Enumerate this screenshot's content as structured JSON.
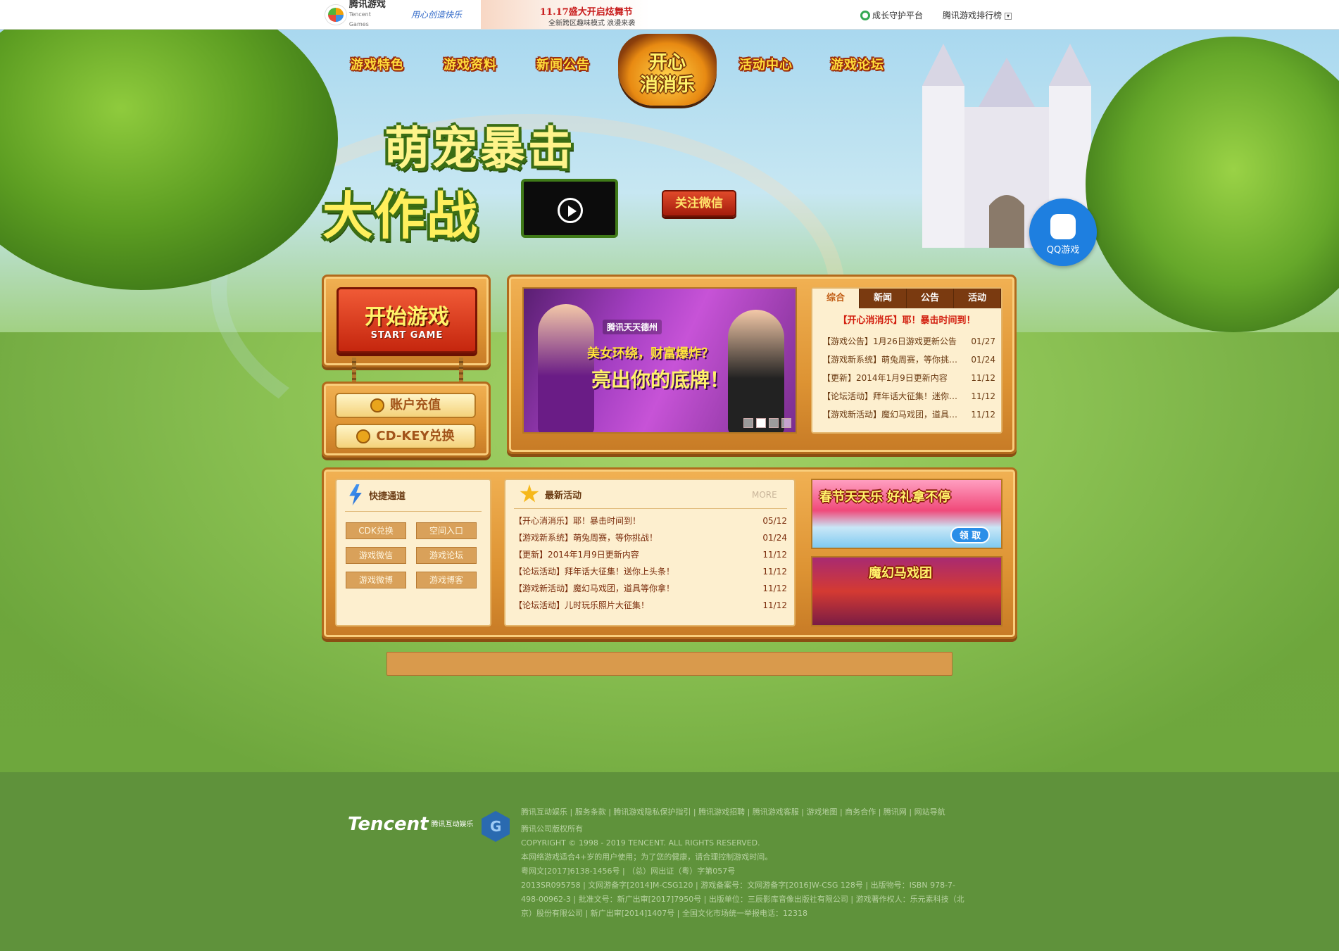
{
  "topbar": {
    "brand_name": "腾讯游戏",
    "brand_en": "Tencent Games",
    "slogan": "用心创造快乐",
    "ad_line1": "11.17盛大开启炫舞节",
    "ad_line2": "全新跨区趣味模式 浪漫来袭",
    "guardian": "成长守护平台",
    "ranking": "腾讯游戏排行榜"
  },
  "nav": {
    "items": [
      "游戏特色",
      "游戏资料",
      "新闻公告",
      "活动中心",
      "游戏论坛"
    ],
    "logo_line1": "开心",
    "logo_line2": "消消乐"
  },
  "hero": {
    "title_line1": "萌宠暴击",
    "title_line2": "大作战",
    "follow_label": "关注微信"
  },
  "qq_float": {
    "label": "QQ游戏"
  },
  "start": {
    "label_cn": "开始游戏",
    "label_en": "START GAME"
  },
  "actions": {
    "recharge": "账户充值",
    "cdkey": "CD-KEY兑换"
  },
  "banner": {
    "brand": "腾讯天天德州",
    "line1": "美女环绕，财富爆炸？",
    "line2": "亮出你的底牌！"
  },
  "news": {
    "tabs": [
      "综合",
      "新闻",
      "公告",
      "活动"
    ],
    "active_tab": "综合",
    "headline": "【开心消消乐】耶！暴击时间到！",
    "items": [
      {
        "title": "【游戏公告】1月26日游戏更新公告",
        "date": "01/27"
      },
      {
        "title": "【游戏新系统】萌兔周赛，等你挑战...",
        "date": "01/24"
      },
      {
        "title": "【更新】2014年1月9日更新内容",
        "date": "11/12"
      },
      {
        "title": "【论坛活动】拜年话大征集！迷你上...",
        "date": "11/12"
      },
      {
        "title": "【游戏新活动】魔幻马戏团，道具等...",
        "date": "11/12"
      }
    ]
  },
  "quick": {
    "title": "快捷通道",
    "buttons": [
      "CDK兑换",
      "空间入口",
      "游戏微信",
      "游戏论坛",
      "游戏微博",
      "游戏博客"
    ]
  },
  "latest": {
    "title": "最新活动",
    "more": "MORE",
    "items": [
      {
        "title": "【开心消消乐】耶！暴击时间到！",
        "date": "05/12"
      },
      {
        "title": "【游戏新系统】萌兔周赛，等你挑战！",
        "date": "01/24"
      },
      {
        "title": "【更新】2014年1月9日更新内容",
        "date": "11/12"
      },
      {
        "title": "【论坛活动】拜年话大征集！送你上头条！",
        "date": "11/12"
      },
      {
        "title": "【游戏新活动】魔幻马戏团，道具等你拿！",
        "date": "11/12"
      },
      {
        "title": "【论坛活动】儿时玩乐照片大征集！",
        "date": "11/12"
      }
    ]
  },
  "promos": {
    "p1_title": "春节天天乐 好礼拿不停",
    "p1_claim": "领 取",
    "p2_title": "魔幻马戏团"
  },
  "footer": {
    "tencent": "Tencent",
    "tencent_sub": "腾讯互动娱乐",
    "links": [
      "腾讯互动娱乐",
      "服务条款",
      "腾讯游戏隐私保护指引",
      "腾讯游戏招聘",
      "腾讯游戏客服",
      "游戏地图",
      "商务合作",
      "腾讯网",
      "网站导航"
    ],
    "rights_cn": "腾讯公司版权所有",
    "copyright": "COPYRIGHT © 1998 - 2019 TENCENT. ALL RIGHTS RESERVED.",
    "age_notice": "本网络游戏适合4+岁的用户使用；为了您的健康，请合理控制游戏时间。",
    "license1": "粤网文[2017]6138-1456号 | （总）网出证（粤）字第057号",
    "license2": "2013SR095758 | 文网游备字[2014]M-CSG120 | 游戏备案号：文网游备字[2016]W-CSG 128号 | 出版物号：ISBN 978-7-",
    "license3": "498-00962-3 | 批准文号：新广出审[2017]7950号 | 出版单位：三辰影库音像出版社有限公司 | 游戏著作权人：乐元素科技（北",
    "license4": "京）股份有限公司 | 新广出审[2014]1407号 | 全国文化市场统一举报电话：12318"
  }
}
